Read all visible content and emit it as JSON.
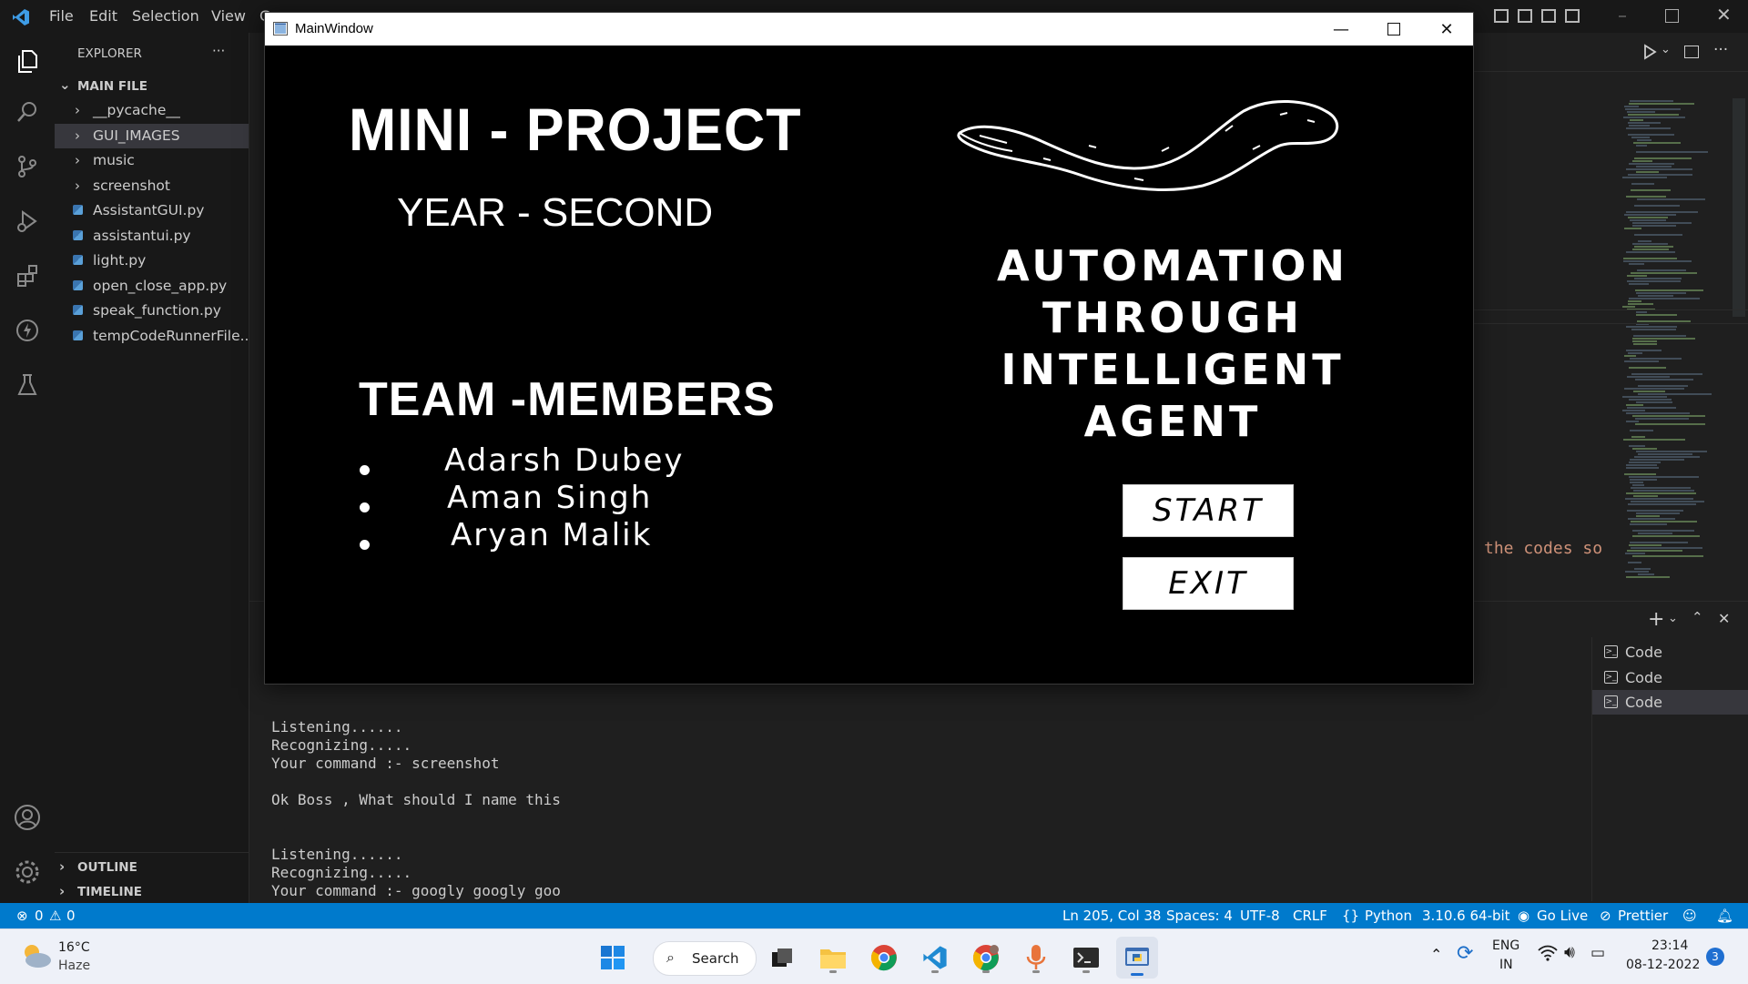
{
  "vscode": {
    "menu": [
      "File",
      "Edit",
      "Selection",
      "View",
      "G"
    ],
    "explorer_title": "EXPLORER",
    "explorer_more": "···",
    "root_folder": "MAIN FILE",
    "tree": [
      {
        "label": "__pycache__",
        "kind": "folder"
      },
      {
        "label": "GUI_IMAGES",
        "kind": "folder",
        "selected": true
      },
      {
        "label": "music",
        "kind": "folder"
      },
      {
        "label": "screenshot",
        "kind": "folder"
      },
      {
        "label": "AssistantGUI.py",
        "kind": "python"
      },
      {
        "label": "assistantui.py",
        "kind": "python"
      },
      {
        "label": "light.py",
        "kind": "python"
      },
      {
        "label": "open_close_app.py",
        "kind": "python"
      },
      {
        "label": "speak_function.py",
        "kind": "python"
      },
      {
        "label": "tempCodeRunnerFile....",
        "kind": "python"
      }
    ],
    "outline": "OUTLINE",
    "timeline": "TIMELINE",
    "code_snippet": "the codes so",
    "terminal_lines": [
      "Listening......",
      "Recognizing.....",
      "Your command :- screenshot",
      "",
      "Ok Boss , What should I name this",
      "",
      "",
      "Listening......",
      "Recognizing.....",
      "Your command :- googly googly goo"
    ],
    "terminals": [
      {
        "label": "Code",
        "selected": false
      },
      {
        "label": "Code",
        "selected": false
      },
      {
        "label": "Code",
        "selected": true
      }
    ],
    "status": {
      "errors": "0",
      "warnings": "0",
      "position": "Ln 205, Col 38",
      "spaces": "Spaces: 4",
      "encoding": "UTF-8",
      "eol": "CRLF",
      "language": "Python",
      "interpreter": "3.10.6 64-bit",
      "golive": "Go Live",
      "prettier": "Prettier"
    },
    "accent_color": "#007acc"
  },
  "app": {
    "window_title": "MainWindow",
    "heading": "MINI - PROJECT",
    "year": "YEAR - SECOND",
    "team_heading": "TEAM -MEMBERS",
    "members": [
      "Adarsh Dubey",
      "Aman Singh",
      "Aryan Malik"
    ],
    "project_title": [
      "AUTOMATION",
      "THROUGH",
      "INTELLIGENT",
      "AGENT"
    ],
    "start_label": "START",
    "exit_label": "EXIT"
  },
  "taskbar": {
    "temperature": "16°C",
    "weather": "Haze",
    "search_label": "Search",
    "lang_1": "ENG",
    "lang_2": "IN",
    "time": "23:14",
    "date": "08-12-2022",
    "notifications": "3",
    "apps": [
      "start-icon",
      "search",
      "task-view-icon",
      "file-explorer-icon",
      "chrome-icon",
      "vscode-icon",
      "chrome-profile-icon",
      "microphone-icon",
      "terminal-icon",
      "python-app-icon"
    ]
  }
}
